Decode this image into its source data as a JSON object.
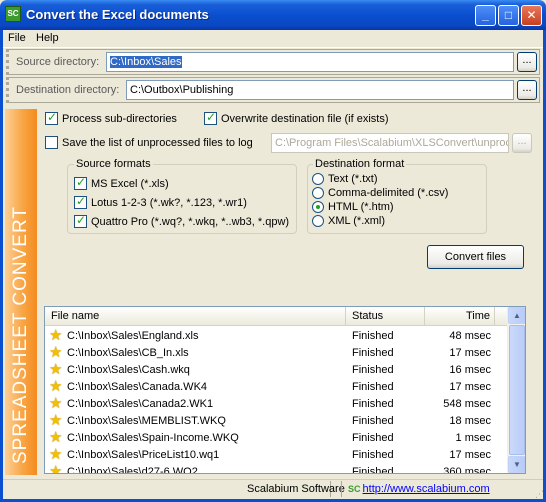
{
  "window": {
    "title": "Convert the Excel documents",
    "icon_label": "SC",
    "controls": {
      "minimize": "_",
      "maximize": "□",
      "close": "✕"
    }
  },
  "menu": {
    "file": "File",
    "help": "Help"
  },
  "source": {
    "label": "Source directory:",
    "value": "C:\\Inbox\\Sales",
    "browse": "..."
  },
  "destination": {
    "label": "Destination directory:",
    "value": "C:\\Outbox\\Publishing",
    "browse": "..."
  },
  "banner": {
    "text": "SPREADSHEET CONVERT",
    "color": "#f48b20"
  },
  "options": {
    "process_subdirs": {
      "label": "Process sub-directories",
      "checked": true
    },
    "overwrite": {
      "label": "Overwrite destination file (if exists)",
      "checked": true
    },
    "save_log": {
      "label": "Save the list of unprocessed files to log",
      "checked": false
    },
    "log_path": "C:\\Program Files\\Scalabium\\XLSConvert\\unproc",
    "log_browse": "..."
  },
  "source_formats": {
    "title": "Source formats",
    "items": [
      {
        "label": "MS Excel (*.xls)",
        "checked": true
      },
      {
        "label": "Lotus 1-2-3 (*.wk?, *.123, *.wr1)",
        "checked": true
      },
      {
        "label": "Quattro Pro (*.wq?, *.wkq, *..wb3, *.qpw)",
        "checked": true
      }
    ]
  },
  "destination_format": {
    "title": "Destination format",
    "items": [
      {
        "label": "Text (*.txt)",
        "checked": false
      },
      {
        "label": "Comma-delimited (*.csv)",
        "checked": false
      },
      {
        "label": "HTML (*.htm)",
        "checked": true
      },
      {
        "label": "XML (*.xml)",
        "checked": false
      }
    ]
  },
  "convert_button": "Convert files",
  "files": {
    "columns": {
      "name": "File name",
      "status": "Status",
      "time": "Time"
    },
    "rows": [
      {
        "file": "C:\\Inbox\\Sales\\England.xls",
        "status": "Finished",
        "time": "48 msec"
      },
      {
        "file": "C:\\Inbox\\Sales\\CB_In.xls",
        "status": "Finished",
        "time": "17 msec"
      },
      {
        "file": "C:\\Inbox\\Sales\\Cash.wkq",
        "status": "Finished",
        "time": "16 msec"
      },
      {
        "file": "C:\\Inbox\\Sales\\Canada.WK4",
        "status": "Finished",
        "time": "17 msec"
      },
      {
        "file": "C:\\Inbox\\Sales\\Canada2.WK1",
        "status": "Finished",
        "time": "548 msec"
      },
      {
        "file": "C:\\Inbox\\Sales\\MEMBLIST.WKQ",
        "status": "Finished",
        "time": "18 msec"
      },
      {
        "file": "C:\\Inbox\\Sales\\Spain-Income.WKQ",
        "status": "Finished",
        "time": "1 msec"
      },
      {
        "file": "C:\\Inbox\\Sales\\PriceList10.wq1",
        "status": "Finished",
        "time": "17 msec"
      },
      {
        "file": "C:\\Inbox\\Sales\\d27-6.WQ2",
        "status": "Finished",
        "time": "360 msec"
      }
    ]
  },
  "statusbar": {
    "company": "Scalabium Software",
    "url": "http://www.scalabium.com",
    "logo": "SC"
  }
}
